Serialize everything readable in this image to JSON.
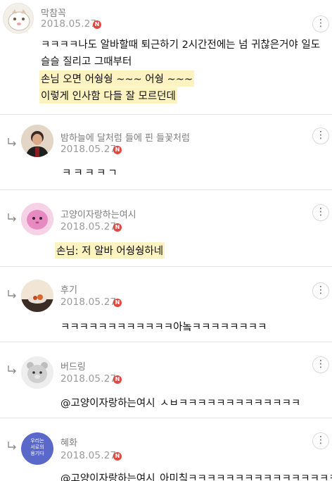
{
  "comments": [
    {
      "nickname": "막참꼭",
      "date": "2018.05.27",
      "lines": [
        "ㅋㅋㅋㅋ나도 알바할때 퇴근하기 2시간전에는 넘 귀찮은거야 일도",
        "슬슬 질리고 그때부터",
        "손님 오면 어쉉쉉 ~~~ 어쉉 ~~~",
        "이렇게 인사함 다들 잘 모르던데"
      ],
      "avatar": "cartoon-face-avatar"
    },
    {
      "nickname": "밤하늘에 달처럼 들에 핀 들꽃처럼",
      "date": "2018.05.27",
      "text": "ㅋㅋㅋㅋㄱ",
      "avatar": "person-photo-avatar"
    },
    {
      "nickname": "고양이자랑하는여시",
      "date": "2018.05.27",
      "text": "손님: 저 알바 어쉉쉉하네",
      "avatar": "pink-character-avatar"
    },
    {
      "nickname": "후기",
      "date": "2018.05.27",
      "text": "ㅋㅋㅋㅋㅋㅋㅋㅋㅋㅋㅋㅋ아놐ㅋㅋㅋㅋㅋㅋㅋㅋ",
      "avatar": "food-photo-avatar"
    },
    {
      "nickname": "버드링",
      "date": "2018.05.27",
      "mention": "@고양이자랑하는여시",
      "text": "ㅅㅂㅋㅋㅋㅋㅋㅋㅋㅋㅋㅋㅋㅋㅋ",
      "avatar": "gray-bear-avatar"
    },
    {
      "nickname": "혜화",
      "date": "2018.05.27",
      "mention": "@고양이자랑하는여시",
      "text": "아미칰ㅋㅋㅋㅋㅋㅋㅋㅋㅋㅋㅋㅋㅋㅋㅋㅋ",
      "avatar": "blue-circle-avatar",
      "avatar_text": [
        "우리는",
        "서로의",
        "용기다"
      ]
    }
  ],
  "badge_letter": "N",
  "more_glyph": "⋮",
  "colors": {
    "badge": "#e0493d",
    "highlight": "#fdf3c0",
    "divider": "#e6e6e6"
  }
}
